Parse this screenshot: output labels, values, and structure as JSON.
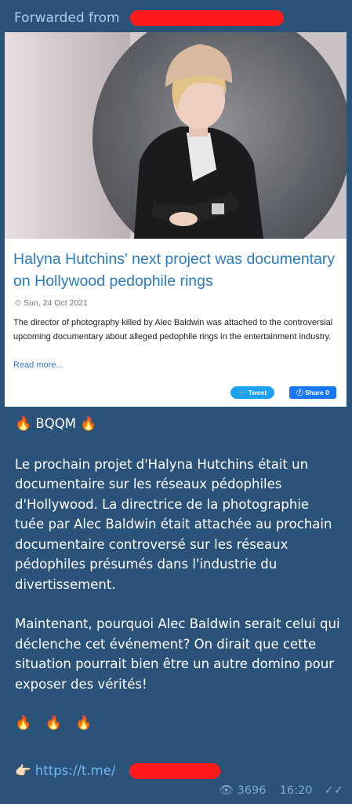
{
  "forward": {
    "label": "Forwarded from"
  },
  "card": {
    "headline": "Halyna Hutchins' next project was documentary on Hollywood pedophile rings",
    "date": "Sun, 24 Oct 2021",
    "summary": "The director of photography killed by Alec Baldwin was attached to the controversial upcoming documentary about alleged pedophile rings in the entertainment industry.",
    "read_more": "Read more...",
    "tweet_label": "Tweet",
    "share_label": "Share 0"
  },
  "message": {
    "title": "BQQM",
    "paragraph1": "Le prochain projet d'Halyna Hutchins était un documentaire sur les réseaux pédophiles d'Hollywood. La directrice de la photographie tuée par Alec Baldwin était attachée au prochain documentaire controversé sur les réseaux pédophiles présumés dans l'industrie du divertissement.",
    "paragraph2": "Maintenant, pourquoi Alec Baldwin serait celui qui déclenche cet événement? On dirait que cette situation pourrait bien être un autre domino pour exposer des vérités!",
    "fires": "🔥 🔥 🔥",
    "link_text": "https://t.me/"
  },
  "meta": {
    "views": "3696",
    "time": "16:20"
  },
  "colors": {
    "bubble": "#2b5278",
    "link": "#71b8f5",
    "redaction": "#ff1a1a"
  },
  "icons": [
    "fire-icon",
    "pointing-hand-icon",
    "eye-icon",
    "double-check-icon",
    "clock-icon",
    "twitter-bird-icon",
    "facebook-icon"
  ]
}
